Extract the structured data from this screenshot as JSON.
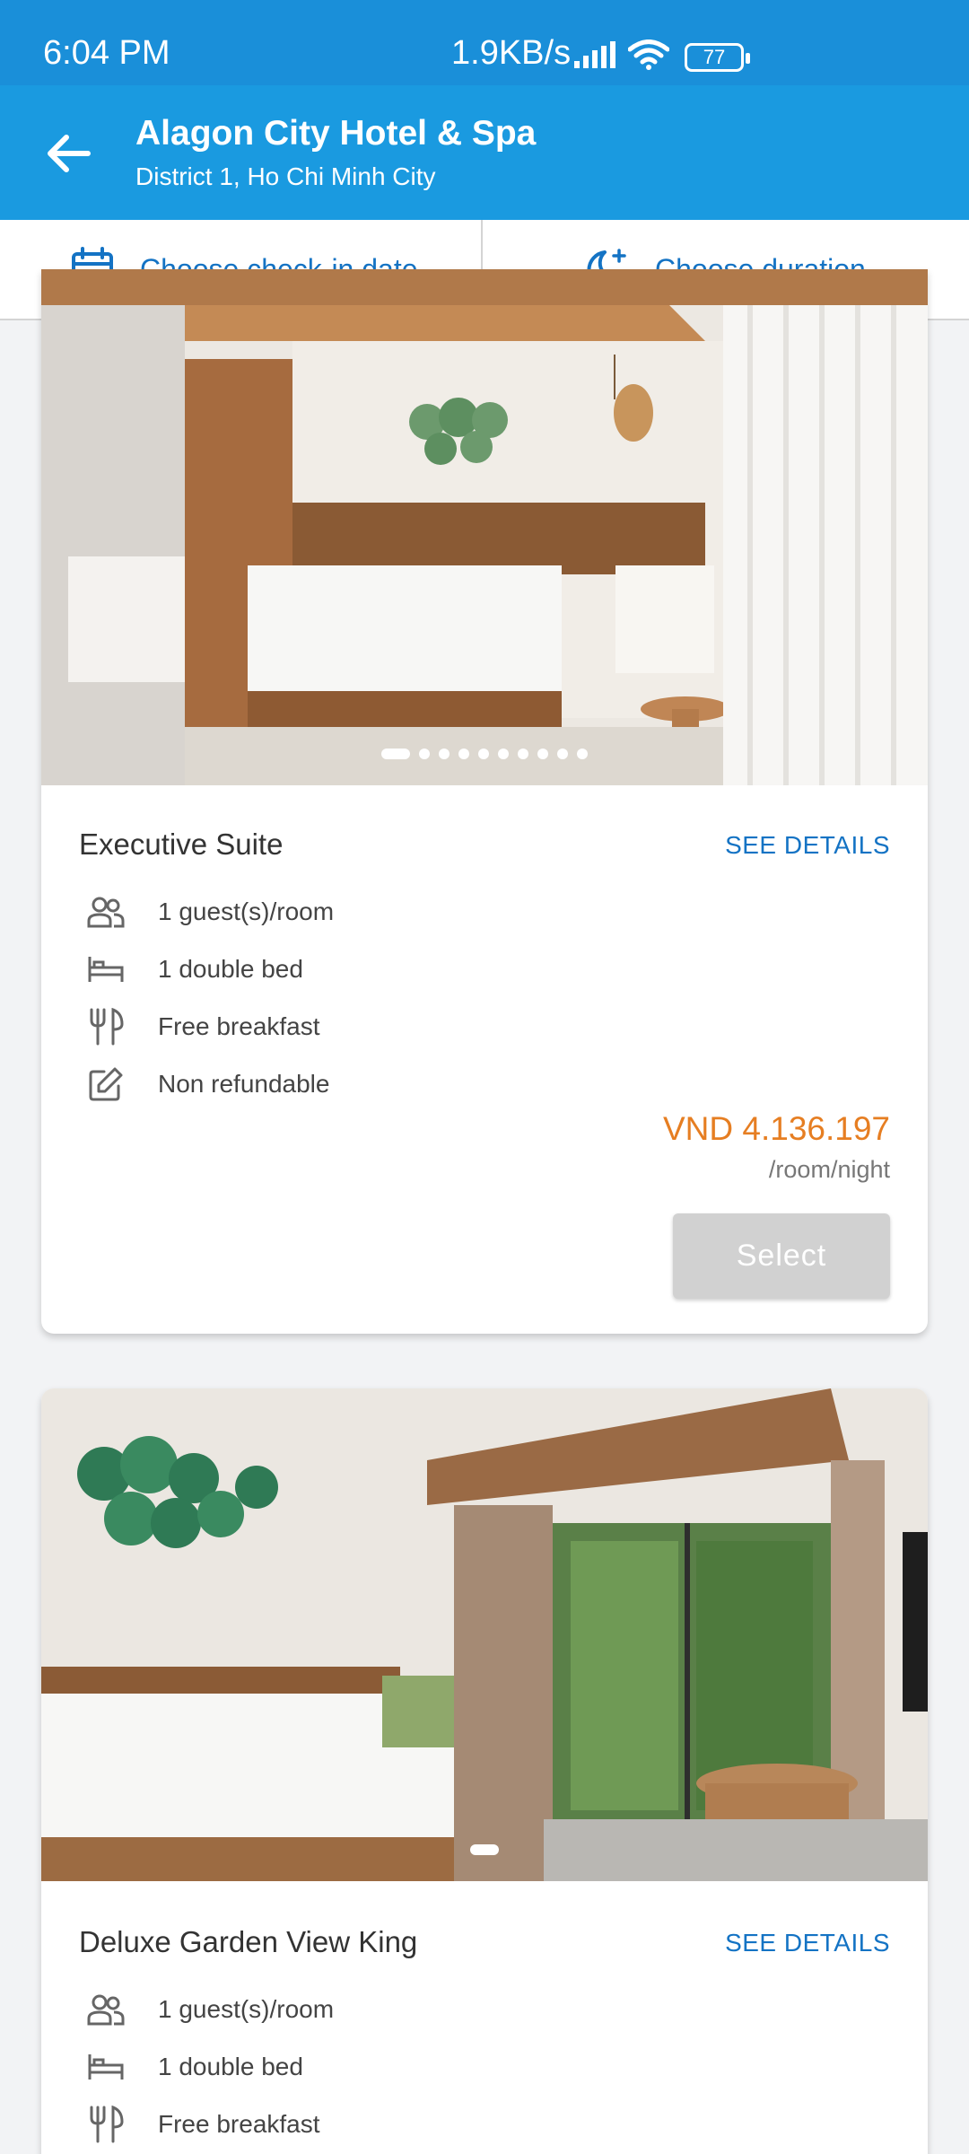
{
  "status_bar": {
    "time": "6:04 PM",
    "net_speed": "1.9KB/s",
    "battery": "77",
    "icons": [
      "signal-icon",
      "wifi-icon",
      "battery-icon"
    ]
  },
  "header": {
    "title": "Alagon City Hotel & Spa",
    "subtitle": "District 1, Ho Chi Minh City",
    "back_icon": "arrow-left-icon"
  },
  "filters": {
    "checkin_label": "Choose check-in date",
    "duration_label": "Choose duration"
  },
  "colors": {
    "primary": "#1a9ae0",
    "status_bar": "#1a8fd9",
    "link": "#1473c4",
    "price": "#e67e22",
    "disabled_button": "#d1d1d1"
  },
  "rooms": [
    {
      "name": "Executive Suite",
      "see_details": "SEE DETAILS",
      "image_count": 10,
      "active_image": 1,
      "amenities": [
        {
          "icon": "guests-icon",
          "label": "1 guest(s)/room"
        },
        {
          "icon": "bed-icon",
          "label": "1 double bed"
        },
        {
          "icon": "cutlery-icon",
          "label": "Free breakfast"
        },
        {
          "icon": "edit-icon",
          "label": "Non refundable"
        }
      ],
      "price": "VND 4.136.197",
      "price_unit": "/room/night",
      "select_label": "Select"
    },
    {
      "name": "Deluxe Garden View King",
      "see_details": "SEE DETAILS",
      "image_count": 1,
      "active_image": 1,
      "amenities": [
        {
          "icon": "guests-icon",
          "label": "1 guest(s)/room"
        },
        {
          "icon": "bed-icon",
          "label": "1 double bed"
        },
        {
          "icon": "cutlery-icon",
          "label": "Free breakfast"
        }
      ]
    }
  ]
}
